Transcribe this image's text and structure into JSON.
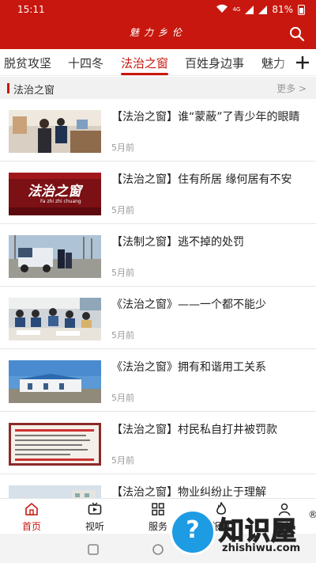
{
  "status_bar": {
    "time": "15:11",
    "network": "4G",
    "battery": "81%"
  },
  "app": {
    "title": "魅力乡伦"
  },
  "tabs": [
    "脱贫攻坚",
    "十四冬",
    "法治之窗",
    "百姓身边事",
    "魅力"
  ],
  "active_tab_index": 2,
  "section": {
    "title": "法治之窗",
    "more_label": "更多 >"
  },
  "news": [
    {
      "title": "【法治之窗】谁“蒙蔽”了青少年的眼睛",
      "time": "5月前",
      "thumb": "indoor-police-scene"
    },
    {
      "title": "【法治之窗】住有所居 缘何居有不安",
      "time": "5月前",
      "thumb": "program-logo",
      "thumb_text": "法治之窗",
      "thumb_sub": "Fa zhi zhi chuang"
    },
    {
      "title": "【法制之窗】逃不掉的处罚",
      "time": "5月前",
      "thumb": "police-truck"
    },
    {
      "title": "《法治之窗》——一个都不能少",
      "time": "5月前",
      "thumb": "classroom"
    },
    {
      "title": "《法治之窗》拥有和谐用工关系",
      "time": "5月前",
      "thumb": "building"
    },
    {
      "title": "【法治之窗】村民私自打井被罚款",
      "time": "5月前",
      "thumb": "documents"
    },
    {
      "title": "【法治之窗】物业纠纷止于理解",
      "time": "",
      "thumb": "apartment"
    }
  ],
  "bottom_nav": [
    "首页",
    "视听",
    "服务",
    "报料",
    "我的"
  ],
  "active_nav_index": 0,
  "watermark": {
    "big": "知识屋",
    "small": "zhishiwu.com",
    "reg": "®",
    "q": "?"
  },
  "colors": {
    "brand": "#c8170e",
    "muted": "#999999"
  }
}
